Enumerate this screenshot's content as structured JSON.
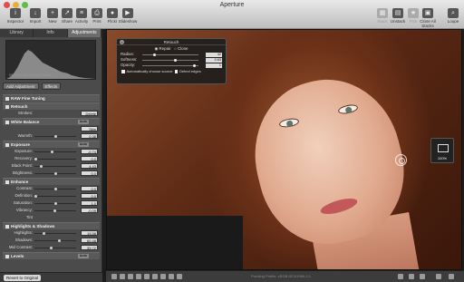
{
  "window": {
    "title": "Aperture"
  },
  "toolbar": {
    "left": [
      {
        "label": "Inspector",
        "icon": "inspector-icon",
        "glyph": "i"
      },
      {
        "label": "Import",
        "icon": "import-icon",
        "glyph": "↓"
      },
      {
        "label": "New",
        "icon": "new-icon",
        "glyph": "+"
      },
      {
        "label": "Share",
        "icon": "share-icon",
        "glyph": "↗"
      },
      {
        "label": "Activity",
        "icon": "activity-icon",
        "glyph": "≡"
      },
      {
        "label": "Print",
        "icon": "print-icon",
        "glyph": "⎙"
      },
      {
        "label": "Flickr",
        "icon": "flickr-icon",
        "glyph": "●"
      },
      {
        "label": "Slideshow",
        "icon": "slideshow-icon",
        "glyph": "▶"
      }
    ],
    "right": [
      {
        "label": "Stack",
        "icon": "stack-icon",
        "glyph": "▦",
        "disabled": true
      },
      {
        "label": "Unstack",
        "icon": "unstack-icon",
        "glyph": "▤",
        "disabled": false
      },
      {
        "label": "Pick",
        "icon": "pick-icon",
        "glyph": "★",
        "disabled": true
      },
      {
        "label": "Close All Stacks",
        "icon": "close-stacks-icon",
        "glyph": "▣",
        "disabled": false
      },
      {
        "label": "Loupe",
        "icon": "loupe-icon",
        "glyph": "⌕",
        "disabled": false
      }
    ]
  },
  "inspector": {
    "tabs": [
      "Library",
      "Info",
      "Adjustments"
    ],
    "active_tab": "Adjustments",
    "histogram": {
      "info": "ISO 200   f/5.6   1/160   70mm"
    },
    "add_adjustment": "Add Adjustment",
    "effects": "Effects",
    "revert": "Revert to Original"
  },
  "sections": [
    {
      "title": "RAW Fine Tuning",
      "auto": false,
      "rows": []
    },
    {
      "title": "Retouch",
      "auto": false,
      "rows": [
        {
          "label": "Strokes:",
          "value": "Delete",
          "knob": null
        }
      ]
    },
    {
      "title": "White Balance",
      "auto": true,
      "auto_label": "Auto",
      "rows": [
        {
          "label": "",
          "value": "Skin Tone",
          "knob": null
        },
        {
          "label": "Warmth:",
          "value": "0.38",
          "knob": 0.52
        }
      ]
    },
    {
      "title": "Exposure",
      "auto": true,
      "auto_label": "Auto",
      "rows": [
        {
          "label": "Exposure:",
          "value": "-0.74",
          "knob": 0.42
        },
        {
          "label": "Recovery:",
          "value": "0.0",
          "knob": 0.0
        },
        {
          "label": "Black Point:",
          "value": "4.43",
          "knob": 0.15
        },
        {
          "label": "Brightness:",
          "value": "0.0",
          "knob": 0.5
        }
      ]
    },
    {
      "title": "Enhance",
      "auto": false,
      "rows": [
        {
          "label": "Contrast:",
          "value": "0.0",
          "knob": 0.5
        },
        {
          "label": "Definition:",
          "value": "0.0",
          "knob": 0.0
        },
        {
          "label": "Saturation:",
          "value": "1.0",
          "knob": 0.5
        },
        {
          "label": "Vibrancy:",
          "value": "-0.09",
          "knob": 0.48
        },
        {
          "label": "Tint",
          "value": "",
          "knob": null
        }
      ]
    },
    {
      "title": "Highlights & Shadows",
      "auto": false,
      "rows": [
        {
          "label": "Highlights:",
          "value": "19.58",
          "knob": 0.2
        },
        {
          "label": "Shadows:",
          "value": "60.48",
          "knob": 0.6
        },
        {
          "label": "Mid Contrast:",
          "value": "39.72",
          "knob": 0.4
        }
      ]
    },
    {
      "title": "Levels",
      "auto": true,
      "auto_label": "Auto",
      "rows": []
    }
  ],
  "retouch_hud": {
    "title": "Retouch",
    "repair": "Repair",
    "clone": "Clone",
    "radius_label": "Radius:",
    "radius_value": "42",
    "radius_knob": 0.2,
    "softness_label": "Softness:",
    "softness_value": "0.63",
    "softness_knob": 0.6,
    "opacity_label": "Opacity:",
    "opacity_value": "1",
    "opacity_knob": 0.95,
    "auto_source": "Automatically choose source",
    "detect_edges": "Detect edges"
  },
  "navigator": {
    "zoom": "100%"
  },
  "statusbar": {
    "proofing": "Proofing Profile: sRGB IEC61966-2.1"
  },
  "colors": {
    "accent": "#6c6c6c",
    "hair": "#8a4a2a",
    "skin": "#e0a98e"
  }
}
